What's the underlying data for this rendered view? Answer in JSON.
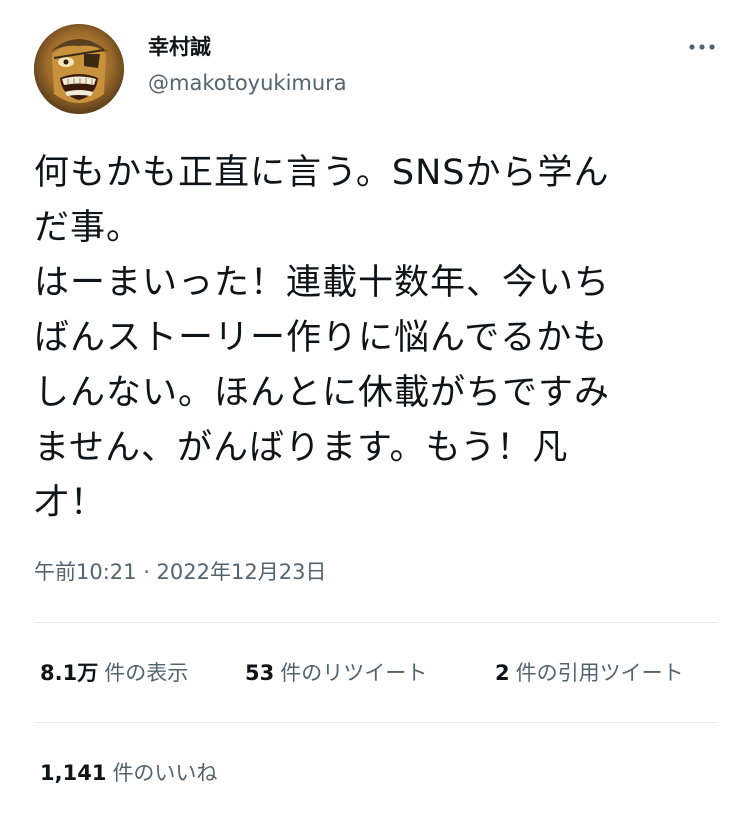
{
  "author": {
    "display_name": "幸村誠",
    "handle": "@makotoyukimura"
  },
  "tweet": {
    "lines": [
      "何もかも正直に言う。SNSから学ん",
      "だ事。",
      "はーまいった！連載十数年、今いち",
      "ばんストーリー作りに悩んでるかも",
      "しんない。ほんとに休載がちですみ",
      "ません、がんばります。もう！凡",
      "才！"
    ],
    "timestamp": "午前10:21 · 2022年12月23日"
  },
  "stats": {
    "views": {
      "count": "8.1万",
      "label": "件の表示"
    },
    "retweets": {
      "count": "53",
      "label": "件のリツイート"
    },
    "quotes": {
      "count": "2",
      "label": "件の引用ツイート"
    },
    "likes": {
      "count": "1,141",
      "label": "件のいいね"
    }
  },
  "icons": {
    "more": "more-horizontal-icon",
    "avatar": "avatar"
  },
  "colors": {
    "text": "#0f1419",
    "secondary_text": "#536471",
    "divider": "#e6e9eb"
  }
}
